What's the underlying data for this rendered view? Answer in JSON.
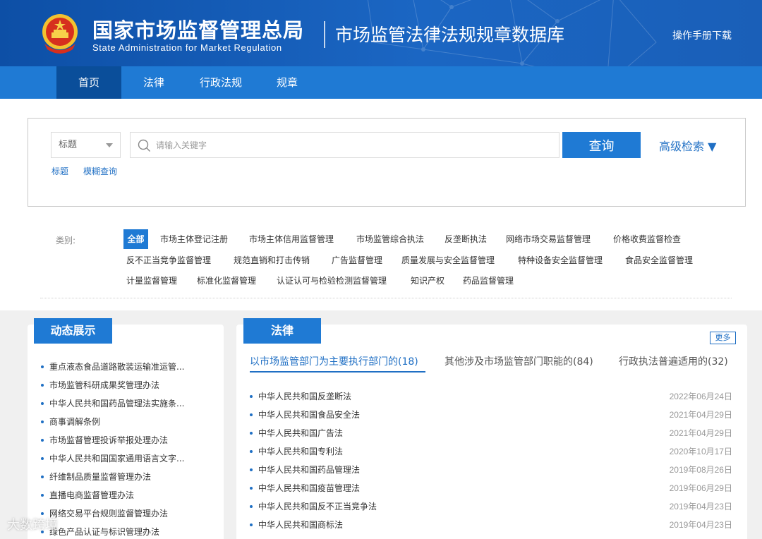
{
  "header": {
    "org_name_cn": "国家市场监督管理总局",
    "org_name_en": "State Administration for Market Regulation",
    "db_title": "市场监管法律法规规章数据库",
    "manual_link": "操作手册下载"
  },
  "nav": {
    "items": [
      {
        "label": "首页",
        "active": true
      },
      {
        "label": "法律",
        "active": false
      },
      {
        "label": "行政法规",
        "active": false
      },
      {
        "label": "规章",
        "active": false
      }
    ]
  },
  "search": {
    "field_select": "标题",
    "placeholder": "请输入关键字",
    "button": "查询",
    "advanced": "高级检索 ▼",
    "modes": [
      "标题",
      "模糊查询"
    ]
  },
  "categories": {
    "label": "类别:",
    "items": [
      "全部",
      "市场主体登记注册",
      "市场主体信用监督管理",
      "市场监管综合执法",
      "反垄断执法",
      "网络市场交易监督管理",
      "价格收费监督检查",
      "反不正当竞争监督管理",
      "规范直销和打击传销",
      "广告监督管理",
      "质量发展与安全监督管理",
      "特种设备安全监督管理",
      "食品安全监督管理",
      "计量监督管理",
      "标准化监督管理",
      "认证认可与检验检测监督管理",
      "知识产权",
      "药品监督管理"
    ]
  },
  "dynamic": {
    "title": "动态展示",
    "items": [
      "重点液态食品道路散装运输准运管...",
      "市场监管科研成果奖管理办法",
      "中华人民共和国药品管理法实施条...",
      "商事调解条例",
      "市场监督管理投诉举报处理办法",
      "中华人民共和国国家通用语言文字...",
      "纤维制品质量监督管理办法",
      "直播电商监督管理办法",
      "网络交易平台规则监督管理办法",
      "绿色产品认证与标识管理办法"
    ]
  },
  "law": {
    "title": "法律",
    "more": "更多",
    "tabs": [
      {
        "label": "以市场监管部门为主要执行部门的(18)",
        "active": true
      },
      {
        "label": "其他涉及市场监管部门职能的(84)",
        "active": false
      },
      {
        "label": "行政执法普遍适用的(32)",
        "active": false
      }
    ],
    "rows": [
      {
        "name": "中华人民共和国反垄断法",
        "date": "2022年06月24日"
      },
      {
        "name": "中华人民共和国食品安全法",
        "date": "2021年04月29日"
      },
      {
        "name": "中华人民共和国广告法",
        "date": "2021年04月29日"
      },
      {
        "name": "中华人民共和国专利法",
        "date": "2020年10月17日"
      },
      {
        "name": "中华人民共和国药品管理法",
        "date": "2019年08月26日"
      },
      {
        "name": "中华人民共和国疫苗管理法",
        "date": "2019年06月29日"
      },
      {
        "name": "中华人民共和国反不正当竞争法",
        "date": "2019年04月23日"
      },
      {
        "name": "中华人民共和国商标法",
        "date": "2019年04月23日"
      }
    ]
  },
  "watermark": "大数跨境",
  "colors": {
    "header_blue": "#1b66c3",
    "nav_blue": "#1f7ad4",
    "nav_active": "#0a4e9a",
    "link_blue": "#1f6fc4"
  }
}
